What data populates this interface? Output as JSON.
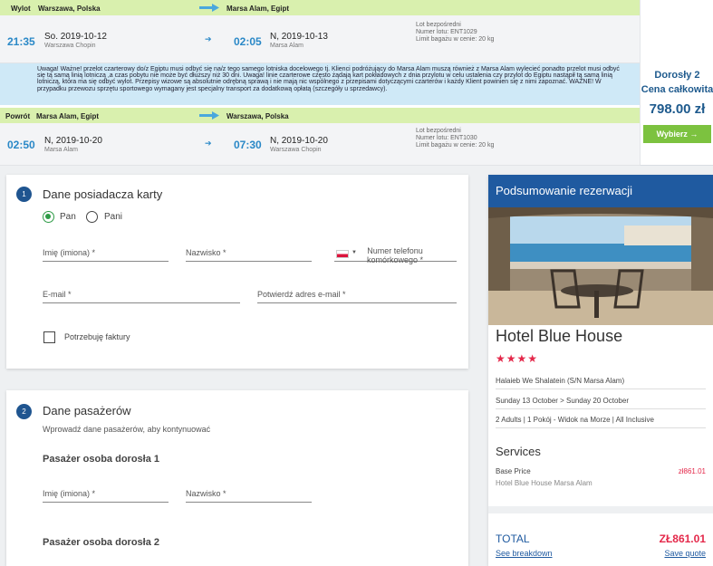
{
  "outbound": {
    "label": "Wylot",
    "from": "Warszawa, Polska",
    "to": "Marsa Alam, Egipt",
    "dep_time": "21:35",
    "dep_date": "So. 2019-10-12",
    "dep_place": "Warszawa Chopin",
    "arr_time": "02:05",
    "arr_date": "N, 2019-10-13",
    "arr_place": "Marsa Alam",
    "info_type": "Lot bezpośredni",
    "info_flight": "Numer lotu: ENT1029",
    "info_baggage": "Limit bagażu w cenie: 20 kg"
  },
  "warning": "Uwaga! Ważne! przelot czarterowy do/z Egiptu musi odbyć się na/z tego samego lotniska docelowego tj. Klienci podróżujący do Marsa Alam muszą również z Marsa Alam wylecieć ponadto przelot musi odbyć się tą samą linią lotniczą ,a czas pobytu nie może być dłuższy niż 30 dni. Uwaga! linie czarterowe często żądają kart pokładowych z dnia przylotu w celu ustalenia czy przylot do Egiptu nastąpił tą samą linią lotniczą, która ma się odbyć wylot. Przepisy wizowe są absolutnie odrębną sprawą i nie mają nic wspólnego z przepisami dotyczącymi czarterów i każdy Klient powinien się z nimi zapoznać. WAŻNE! W przypadku przewozu sprzętu sportowego wymagany jest specjalny transport za dodatkową opłatą (szczegóły u sprzedawcy).",
  "inbound": {
    "label": "Powrót",
    "from": "Marsa Alam, Egipt",
    "to": "Warszawa, Polska",
    "dep_time": "02:50",
    "dep_date": "N, 2019-10-20",
    "dep_place": "Marsa Alam",
    "arr_time": "07:30",
    "arr_date": "N, 2019-10-20",
    "arr_place": "Warszawa Chopin",
    "info_type": "Lot bezpośredni",
    "info_flight": "Numer lotu: ENT1030",
    "info_baggage": "Limit bagażu w cenie: 20 kg"
  },
  "price_panel": {
    "passengers": "Dorosły 2",
    "total_label": "Cena całkowita",
    "price": "798.00 zł",
    "choose_button": "Wybierz →"
  },
  "card_holder": {
    "step": "1",
    "title": "Dane posiadacza karty",
    "radio_mr": "Pan",
    "radio_mrs": "Pani",
    "first_name": "Imię (imiona) *",
    "last_name": "Nazwisko *",
    "phone": "Numer telefonu komórkowego *",
    "email": "E-mail *",
    "email_confirm": "Potwierdź adres e-mail *",
    "invoice": "Potrzebuję faktury"
  },
  "passengers": {
    "step": "2",
    "title": "Dane pasażerów",
    "hint": "Wprowadź dane pasażerów, aby kontynuować",
    "adult1": "Pasażer osoba dorosła 1",
    "first_name": "Imię (imiona) *",
    "last_name": "Nazwisko *",
    "adult2": "Pasażer osoba dorosła 2"
  },
  "summary": {
    "header": "Podsumowanie rezerwacji",
    "hotel_name": "Hotel Blue House",
    "stars": "★★★★",
    "address": "Halaieb We Shalatein (S/N Marsa Alam)",
    "dates": "Sunday 13 October  >  Sunday 20 October",
    "room": "2 Adults | 1 Pokój - Widok na Morze | All Inclusive",
    "services_title": "Services",
    "base_price_label": "Base Price",
    "base_price_value": "zł861.01",
    "base_price_sub": "Hotel Blue House Marsa Alam",
    "total_label": "TOTAL",
    "total_value": "ZŁ861.01",
    "see_breakdown": "See breakdown",
    "save_quote": "Save quote"
  },
  "colors": {
    "accent_blue": "#1f5aa0",
    "leg_green": "#d9f0ae",
    "button_green": "#7cc23f",
    "price_red": "#e4284a"
  }
}
